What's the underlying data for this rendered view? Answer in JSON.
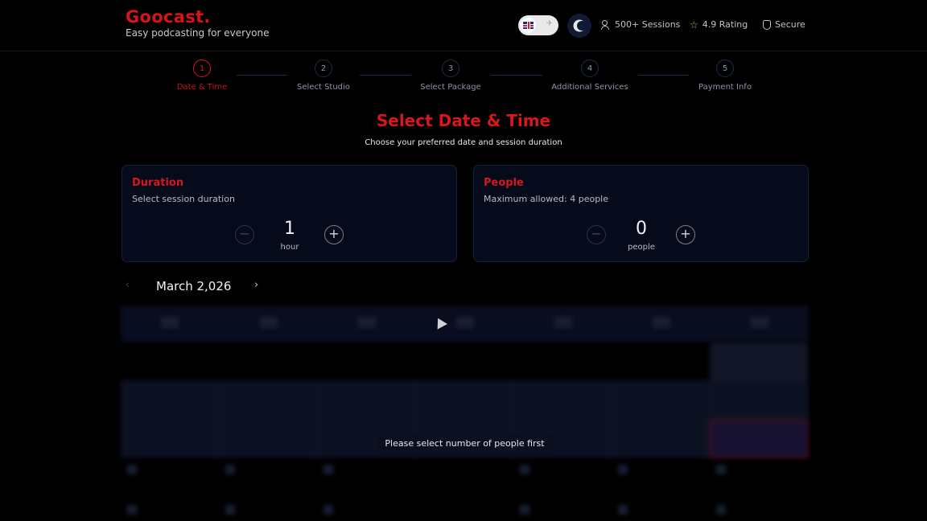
{
  "brand": {
    "name": "Goocast.",
    "tagline": "Easy podcasting for everyone"
  },
  "header": {
    "lang_alt": "✈",
    "stats": [
      {
        "icon": "users-icon",
        "label": "500+ Sessions"
      },
      {
        "icon": "star-icon",
        "label": "4.9 Rating"
      },
      {
        "icon": "shield-icon",
        "label": "Secure"
      }
    ]
  },
  "steps": [
    {
      "num": "1",
      "label": "Date & Time",
      "active": true
    },
    {
      "num": "2",
      "label": "Select Studio",
      "active": false
    },
    {
      "num": "3",
      "label": "Select Package",
      "active": false
    },
    {
      "num": "4",
      "label": "Additional Services",
      "active": false
    },
    {
      "num": "5",
      "label": "Payment Info",
      "active": false
    }
  ],
  "page": {
    "title": "Select Date & Time",
    "subtitle": "Choose your preferred date and session duration"
  },
  "duration": {
    "title": "Duration",
    "subtitle": "Select session duration",
    "value": "1",
    "unit": "hour",
    "minus": "−",
    "plus": "+"
  },
  "people": {
    "title": "People",
    "subtitle": "Maximum allowed: 4 people",
    "value": "0",
    "unit": "people",
    "minus": "−",
    "plus": "+"
  },
  "calendar": {
    "month": "March 2,026",
    "prev": "‹",
    "next": "›"
  },
  "toast": {
    "message": "Please select number of people first"
  },
  "colors": {
    "accent": "#d8171b",
    "card_bg": "#060b1c",
    "page_bg": "#000000"
  }
}
